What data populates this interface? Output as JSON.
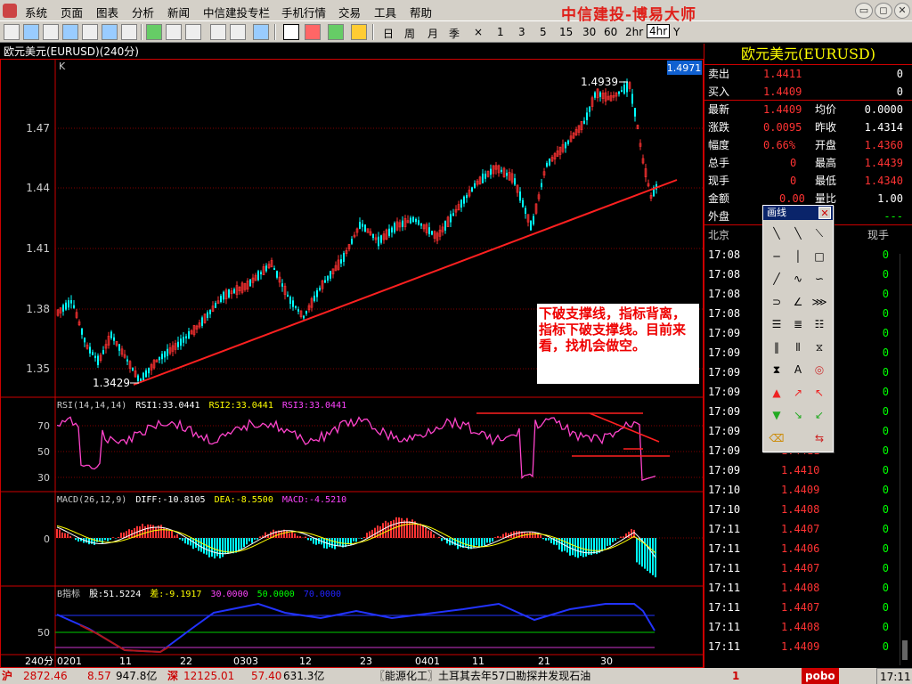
{
  "menu": {
    "items": [
      "系统",
      "页面",
      "图表",
      "分析",
      "新闻",
      "中信建投专栏",
      "手机行情",
      "交易",
      "工具",
      "帮助"
    ],
    "brand": "中信建投-博易大师"
  },
  "toolbar": {
    "periods": [
      "日",
      "周",
      "月",
      "季",
      "×",
      "1",
      "3",
      "5",
      "15",
      "30",
      "60",
      "2hr",
      "4hr",
      "Y"
    ],
    "selected_period": "4hr"
  },
  "window": {
    "title": "欧元美元(EURUSD)(240分)",
    "price_label": "K",
    "current_price_tag": "1.4971"
  },
  "main_chart": {
    "y_labels": [
      "1.47",
      "1.44",
      "1.41",
      "1.38",
      "1.35"
    ],
    "high_label": "1.4939",
    "low_label": "1.3429"
  },
  "annotation": {
    "text": "下破支撑线，指标背离，指标下破支撑线。目前来看，找机会做空。"
  },
  "rsi": {
    "header": "RSI(14,14,14)",
    "rsi1": "RSI1:33.0441",
    "rsi2": "RSI2:33.0441",
    "rsi3": "RSI3:33.0441",
    "y_labels": [
      "70",
      "50",
      "30"
    ]
  },
  "macd": {
    "header": "MACD(26,12,9)",
    "diff": "DIFF:-10.8105",
    "dea": "DEA:-8.5500",
    "macd": "MACD:-4.5210",
    "y_label": "0"
  },
  "b_indicator": {
    "header": "B指标",
    "stock": "股:51.5224",
    "diff": "差:-9.1917",
    "v1": "30.0000",
    "v2": "50.0000",
    "v3": "70.0000",
    "y_label": "50"
  },
  "x_axis": {
    "period_label": "240分",
    "labels": [
      "0201",
      "11",
      "22",
      "0303",
      "12",
      "23",
      "0401",
      "11",
      "21",
      "30"
    ]
  },
  "quote": {
    "title": "欧元美元(EURUSD)",
    "sell_label": "卖出",
    "sell_price": "1.4411",
    "sell_vol": "0",
    "buy_label": "买入",
    "buy_price": "1.4409",
    "buy_vol": "0",
    "latest_label": "最新",
    "latest": "1.4409",
    "avg_label": "均价",
    "avg": "0.0000",
    "change_label": "涨跌",
    "change": "0.0095",
    "prev_label": "昨收",
    "prev": "1.4314",
    "range_label": "幅度",
    "range": "0.66%",
    "open_label": "开盘",
    "open": "1.4360",
    "total_label": "总手",
    "total": "0",
    "high_label": "最高",
    "high": "1.4439",
    "now_label": "现手",
    "now": "0",
    "low_label": "最低",
    "low": "1.4340",
    "amount_label": "金额",
    "amount": "0.00",
    "ratio_label": "量比",
    "ratio": "1.00",
    "outer_label": "外盘",
    "outer_val": "---"
  },
  "ticks": {
    "header_time": "北京",
    "header_vol": "现手",
    "rows": [
      {
        "time": "17:08",
        "price": "",
        "vol": "0"
      },
      {
        "time": "17:08",
        "price": "",
        "vol": "0"
      },
      {
        "time": "17:08",
        "price": "",
        "vol": "0"
      },
      {
        "time": "17:08",
        "price": "",
        "vol": "0"
      },
      {
        "time": "17:09",
        "price": "",
        "vol": "0"
      },
      {
        "time": "17:09",
        "price": "",
        "vol": "0"
      },
      {
        "time": "17:09",
        "price": "",
        "vol": "0"
      },
      {
        "time": "17:09",
        "price": "",
        "vol": "0"
      },
      {
        "time": "17:09",
        "price": "",
        "vol": "0"
      },
      {
        "time": "17:09",
        "price": "",
        "vol": "0"
      },
      {
        "time": "17:09",
        "price": "1.4411",
        "vol": "0"
      },
      {
        "time": "17:09",
        "price": "1.4410",
        "vol": "0"
      },
      {
        "time": "17:10",
        "price": "1.4409",
        "vol": "0"
      },
      {
        "time": "17:10",
        "price": "1.4408",
        "vol": "0"
      },
      {
        "time": "17:11",
        "price": "1.4407",
        "vol": "0"
      },
      {
        "time": "17:11",
        "price": "1.4406",
        "vol": "0"
      },
      {
        "time": "17:11",
        "price": "1.4407",
        "vol": "0"
      },
      {
        "time": "17:11",
        "price": "1.4408",
        "vol": "0"
      },
      {
        "time": "17:11",
        "price": "1.4407",
        "vol": "0"
      },
      {
        "time": "17:11",
        "price": "1.4408",
        "vol": "0"
      },
      {
        "time": "17:11",
        "price": "1.4409",
        "vol": "0"
      }
    ]
  },
  "palette": {
    "title": "画线",
    "close": "✕"
  },
  "status": {
    "sh_label": "沪",
    "sh_index": "2872.46",
    "sh_change": "8.57",
    "sh_amount": "947.8亿",
    "sz_label": "深",
    "sz_index": "12125.01",
    "sz_change": "57.40",
    "sz_amount": "631.3亿",
    "news": "〖能源化工〗土耳其去年57口勘探井发现石油",
    "alert": "1",
    "pobo": "pobo",
    "clock": "17:11"
  },
  "colors": {
    "up": "#ff3333",
    "down": "#00ffff",
    "support_line": "#ff2020",
    "rsi_line": "#ff44cc",
    "grid": "#800000",
    "b_line_blue": "#2233ff",
    "b_line_red": "#cc2020"
  }
}
